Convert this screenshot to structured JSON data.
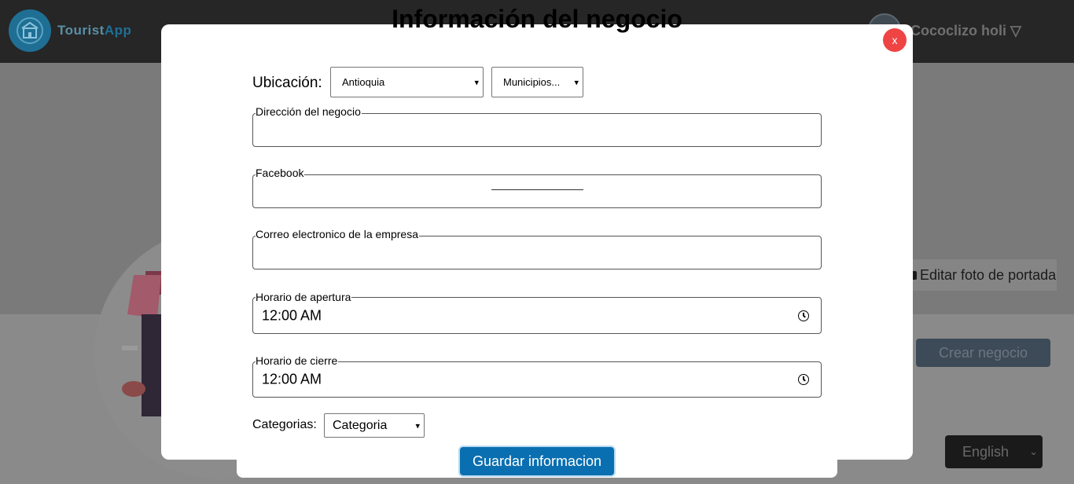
{
  "header": {
    "logo_text_a": "Tourist",
    "logo_text_b": "App",
    "user_name": "Cococlizo holi ▽"
  },
  "background": {
    "edit_cover_label": "Editar foto de portada",
    "create_business_label": "Crear negocio",
    "language_selected": "English"
  },
  "modal": {
    "title": "Información del negocio",
    "close_label": "x",
    "location_label": "Ubicación:",
    "department_selected": "Antioquia",
    "municipality_selected": "Municipios...",
    "fields": {
      "address_label": "Dirección del negocio",
      "address_value": "",
      "facebook_label": "Facebook",
      "facebook_value": "",
      "email_label": "Correo electronico de la empresa",
      "email_value": "",
      "opening_label": "Horario de apertura",
      "opening_value": "12:00  AM",
      "closing_label": "Horario de cierre",
      "closing_value": "12:00  AM"
    },
    "categories_label": "Categorias:",
    "category_selected": "Categoria",
    "save_label": "Guardar informacion"
  },
  "colors": {
    "accent": "#0a6fb0",
    "close": "#ef4444",
    "topbar": "#262626"
  }
}
